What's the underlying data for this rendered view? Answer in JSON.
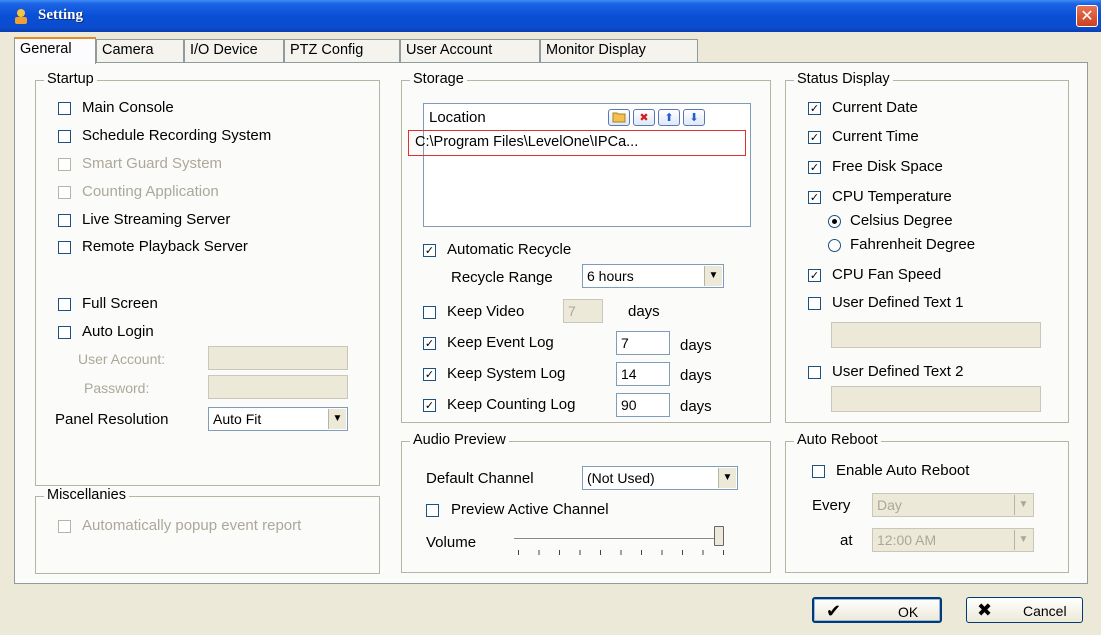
{
  "window": {
    "title": "Setting",
    "close_glyph": "✕"
  },
  "tabs": [
    {
      "label": "General",
      "active": true
    },
    {
      "label": "Camera"
    },
    {
      "label": "I/O Device"
    },
    {
      "label": "PTZ Config"
    },
    {
      "label": "User Account"
    },
    {
      "label": "Monitor Display"
    }
  ],
  "startup": {
    "title": "Startup",
    "items": [
      {
        "label": "Main Console",
        "checked": false,
        "enabled": true
      },
      {
        "label": "Schedule Recording System",
        "checked": false,
        "enabled": true
      },
      {
        "label": "Smart Guard System",
        "checked": false,
        "enabled": false
      },
      {
        "label": "Counting Application",
        "checked": false,
        "enabled": false
      },
      {
        "label": "Live Streaming Server",
        "checked": false,
        "enabled": true
      },
      {
        "label": "Remote Playback Server",
        "checked": false,
        "enabled": true
      },
      {
        "label": "Full Screen",
        "checked": false,
        "enabled": true
      },
      {
        "label": "Auto Login",
        "checked": false,
        "enabled": true
      }
    ],
    "user_account_label": "User Account:",
    "user_account_value": "",
    "password_label": "Password:",
    "password_value": "",
    "panel_resolution_label": "Panel Resolution",
    "panel_resolution_value": "Auto Fit"
  },
  "miscellanies": {
    "title": "Miscellanies",
    "auto_popup_label": "Automatically popup event report",
    "auto_popup_checked": false
  },
  "storage": {
    "title": "Storage",
    "location_header": "Location",
    "locations": [
      "C:\\Program Files\\LevelOne\\IPCa..."
    ],
    "auto_recycle_label": "Automatic Recycle",
    "auto_recycle_checked": true,
    "recycle_range_label": "Recycle Range",
    "recycle_range_value": "6 hours",
    "keep_video_label": "Keep Video",
    "keep_video_checked": false,
    "keep_video_days": "7",
    "keep_event_label": "Keep Event Log",
    "keep_event_checked": true,
    "keep_event_days": "7",
    "keep_system_label": "Keep System Log",
    "keep_system_checked": true,
    "keep_system_days": "14",
    "keep_counting_label": "Keep Counting Log",
    "keep_counting_checked": true,
    "keep_counting_days": "90",
    "days_label": "days"
  },
  "audio": {
    "title": "Audio Preview",
    "default_channel_label": "Default Channel",
    "default_channel_value": "(Not Used)",
    "preview_active_label": "Preview Active Channel",
    "preview_active_checked": false,
    "volume_label": "Volume",
    "volume_level": 1.0
  },
  "status_display": {
    "title": "Status Display",
    "current_date_label": "Current Date",
    "current_time_label": "Current Time",
    "free_disk_label": "Free Disk Space",
    "cpu_temp_label": "CPU Temperature",
    "celsius_label": "Celsius Degree",
    "fahrenheit_label": "Fahrenheit Degree",
    "cpu_fan_label": "CPU Fan Speed",
    "user_text1_label": "User Defined Text 1",
    "user_text1_value": "",
    "user_text2_label": "User Defined Text 2",
    "user_text2_value": ""
  },
  "auto_reboot": {
    "title": "Auto Reboot",
    "enable_label": "Enable Auto Reboot",
    "enable_checked": false,
    "every_label": "Every",
    "every_value": "Day",
    "at_label": "at",
    "at_value": "12:00 AM"
  },
  "buttons": {
    "ok": "OK",
    "cancel": "Cancel"
  },
  "colors": {
    "titlebar": "#0a4fd6",
    "selection_border": "#e03030",
    "face": "#ece9d8"
  }
}
